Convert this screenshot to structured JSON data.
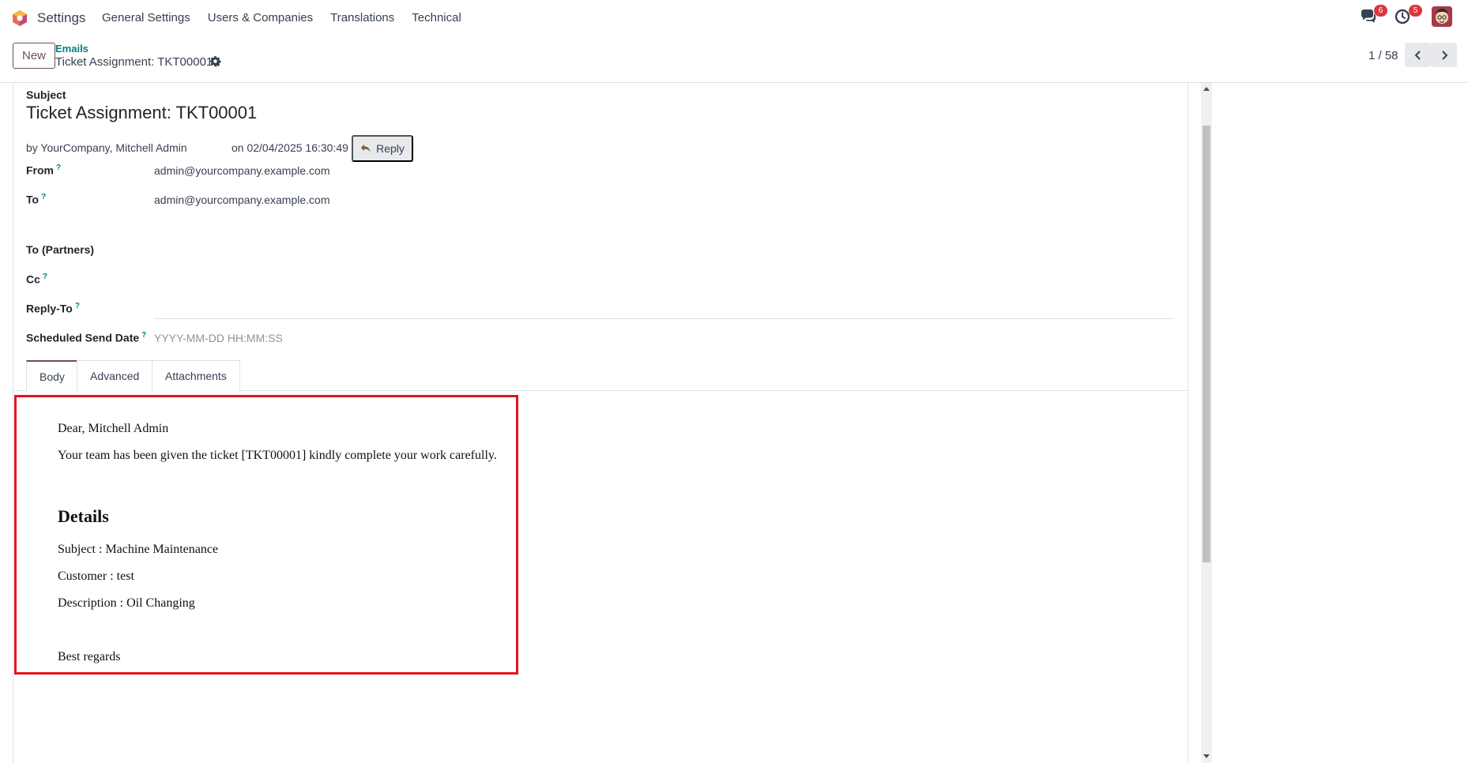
{
  "navbar": {
    "app_name": "Settings",
    "menu": [
      "General Settings",
      "Users & Companies",
      "Translations",
      "Technical"
    ],
    "messages_badge": "6",
    "activities_badge": "5"
  },
  "control_panel": {
    "new_label": "New",
    "breadcrumb_parent": "Emails",
    "breadcrumb_current": "Ticket Assignment: TKT00001",
    "pager": "1 / 58"
  },
  "form": {
    "subject_label": "Subject",
    "subject_value": "Ticket Assignment: TKT00001",
    "by_line": "by YourCompany, Mitchell Admin",
    "on_line": "on 02/04/2025 16:30:49",
    "reply_label": "Reply",
    "from_label": "From",
    "from_value": "admin@yourcompany.example.com",
    "to_label": "To",
    "to_value": "admin@yourcompany.example.com",
    "to_partners_label": "To (Partners)",
    "cc_label": "Cc",
    "reply_to_label": "Reply-To",
    "scheduled_label": "Scheduled Send Date",
    "scheduled_placeholder": "YYYY-MM-DD HH:MM:SS",
    "help_mark": "?"
  },
  "tabs": [
    "Body",
    "Advanced",
    "Attachments"
  ],
  "email_body": {
    "greeting": "Dear, Mitchell Admin",
    "intro": "Your team has been given the ticket [TKT00001] kindly complete your work carefully.",
    "details_heading": "Details",
    "subject_line": "Subject : Machine Maintenance",
    "customer_line": "Customer : test",
    "description_line": "Description : Oil Changing",
    "closing": "Best regards"
  },
  "colors": {
    "brand": "#714b67",
    "link": "#017e84",
    "highlight_border": "#e3141b",
    "badge": "#d9363e"
  }
}
